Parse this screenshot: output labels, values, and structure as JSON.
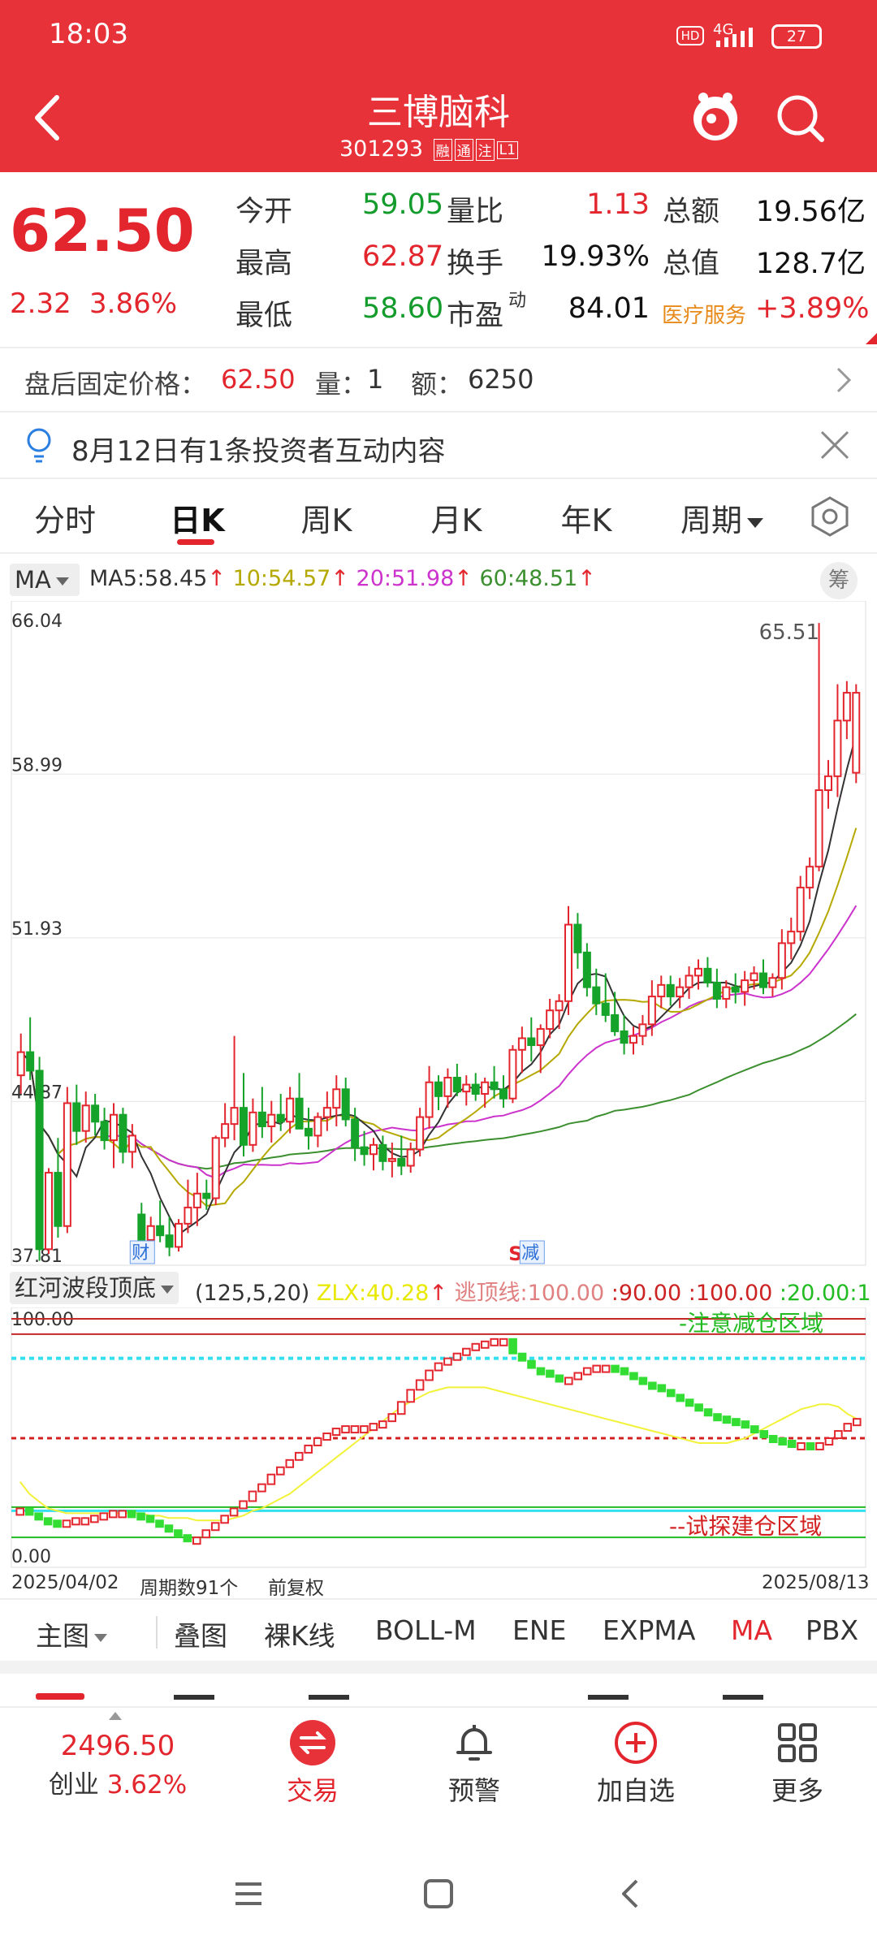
{
  "status_bar": {
    "time": "18:03",
    "network": "4G",
    "battery": "27"
  },
  "header": {
    "title": "三博脑科",
    "code": "301293",
    "badges": [
      "融",
      "通",
      "注",
      "L1"
    ]
  },
  "quote": {
    "price": "62.50",
    "change": "2.32",
    "change_pct": "3.86%",
    "open_label": "今开",
    "open": "59.05",
    "high_label": "最高",
    "high": "62.87",
    "low_label": "最低",
    "low": "58.60",
    "volratio_label": "量比",
    "volratio": "1.13",
    "turnover_label": "换手",
    "turnover": "19.93%",
    "pe_label": "市盈",
    "pe_sup": "动",
    "pe": "84.01",
    "amount_label": "总额",
    "amount": "19.56亿",
    "mktcap_label": "总值",
    "mktcap": "128.7亿",
    "sector": "医疗服务",
    "sector_pct": "+3.89%"
  },
  "afterhours": {
    "label": "盘后固定价格：",
    "price": "62.50",
    "vol_label": "量：",
    "vol": "1",
    "amt_label": "额：",
    "amt": "6250"
  },
  "notice": {
    "text": "8月12日有1条投资者互动内容"
  },
  "period_tabs": [
    "分时",
    "日K",
    "周K",
    "月K",
    "年K",
    "周期"
  ],
  "ma_legend": {
    "selector": "MA",
    "ma5": "MA5:58.45",
    "ma10": "10:54.57",
    "ma20": "20:51.98",
    "ma60": "60:48.51",
    "chip_btn": "筹"
  },
  "colors": {
    "up": "#e3262e",
    "down": "#16a32a",
    "ma5": "#333333",
    "ma10": "#b5a800",
    "ma20": "#cc33cc",
    "ma60": "#3b8f2e"
  },
  "chart_data": [
    {
      "type": "candlestick",
      "title": "",
      "ylim": [
        37.81,
        66.04
      ],
      "yticks": [
        "66.04",
        "58.99",
        "51.93",
        "44.87",
        "37.81"
      ],
      "x_range": [
        "2025/04/02",
        "2025/08/13"
      ],
      "period_count_label": "周期数91个",
      "adjust_label": "前复权",
      "max_label": "65.51",
      "event_markers": [
        {
          "label": "财",
          "index": 13
        },
        {
          "label": "减",
          "index": 55,
          "prefix": "S"
        }
      ],
      "ohlc": [
        [
          46.0,
          47.8,
          45.2,
          47.0
        ],
        [
          47.0,
          48.5,
          45.8,
          46.2
        ],
        [
          46.2,
          46.8,
          38.0,
          38.5
        ],
        [
          38.5,
          42.0,
          38.3,
          41.8
        ],
        [
          41.8,
          43.3,
          39.0,
          39.5
        ],
        [
          39.5,
          45.5,
          39.2,
          44.8
        ],
        [
          44.8,
          45.6,
          43.0,
          43.6
        ],
        [
          43.6,
          45.3,
          43.1,
          44.7
        ],
        [
          44.7,
          45.2,
          43.4,
          44.0
        ],
        [
          44.0,
          44.6,
          42.8,
          43.2
        ],
        [
          43.2,
          44.8,
          42.0,
          44.3
        ],
        [
          44.3,
          44.6,
          42.2,
          42.7
        ],
        [
          42.7,
          43.9,
          42.0,
          43.4
        ],
        [
          40.0,
          40.5,
          38.3,
          38.9
        ],
        [
          38.9,
          39.9,
          38.1,
          39.5
        ],
        [
          39.5,
          40.6,
          38.8,
          39.1
        ],
        [
          39.1,
          39.9,
          38.2,
          38.6
        ],
        [
          38.6,
          39.8,
          38.4,
          39.6
        ],
        [
          39.6,
          41.5,
          39.2,
          40.3
        ],
        [
          40.3,
          41.8,
          39.5,
          40.9
        ],
        [
          40.9,
          41.5,
          40.2,
          40.7
        ],
        [
          40.7,
          43.4,
          40.4,
          43.3
        ],
        [
          43.3,
          44.8,
          42.9,
          43.9
        ],
        [
          43.9,
          47.7,
          43.2,
          44.6
        ],
        [
          44.6,
          46.1,
          42.5,
          43.0
        ],
        [
          43.0,
          45.0,
          42.7,
          44.4
        ],
        [
          44.4,
          45.5,
          43.3,
          43.8
        ],
        [
          43.8,
          44.9,
          43.1,
          44.3
        ],
        [
          44.3,
          45.2,
          43.6,
          44.0
        ],
        [
          44.0,
          45.5,
          43.5,
          45.0
        ],
        [
          45.0,
          46.1,
          43.9,
          43.7
        ],
        [
          43.7,
          44.6,
          42.8,
          43.4
        ],
        [
          43.4,
          44.4,
          42.9,
          44.2
        ],
        [
          44.2,
          45.3,
          43.6,
          44.6
        ],
        [
          44.6,
          46.0,
          43.8,
          45.4
        ],
        [
          45.4,
          45.9,
          43.8,
          44.1
        ],
        [
          44.1,
          44.6,
          42.3,
          42.9
        ],
        [
          42.9,
          43.6,
          42.1,
          42.6
        ],
        [
          42.6,
          43.3,
          41.9,
          43.0
        ],
        [
          43.0,
          43.4,
          41.9,
          42.3
        ],
        [
          42.3,
          43.1,
          41.6,
          42.4
        ],
        [
          42.4,
          43.4,
          41.7,
          42.1
        ],
        [
          42.1,
          43.1,
          41.8,
          42.8
        ],
        [
          42.8,
          44.6,
          42.5,
          44.2
        ],
        [
          44.2,
          46.4,
          43.7,
          45.7
        ],
        [
          45.7,
          46.0,
          44.5,
          45.1
        ],
        [
          45.1,
          46.3,
          44.6,
          45.9
        ],
        [
          45.9,
          46.5,
          45.1,
          45.3
        ],
        [
          45.3,
          46.0,
          44.7,
          45.6
        ],
        [
          45.6,
          46.1,
          44.9,
          45.2
        ],
        [
          45.2,
          45.9,
          44.6,
          45.7
        ],
        [
          45.7,
          46.4,
          45.0,
          45.4
        ],
        [
          45.4,
          46.0,
          44.6,
          45.0
        ],
        [
          45.0,
          47.3,
          44.8,
          47.1
        ],
        [
          47.1,
          48.1,
          46.1,
          47.6
        ],
        [
          47.6,
          48.5,
          46.6,
          47.3
        ],
        [
          47.3,
          48.2,
          46.1,
          48.0
        ],
        [
          48.0,
          49.3,
          47.6,
          48.8
        ],
        [
          48.8,
          49.5,
          48.0,
          49.2
        ],
        [
          49.2,
          53.3,
          48.6,
          52.5
        ],
        [
          52.5,
          53.0,
          50.6,
          51.3
        ],
        [
          51.3,
          51.7,
          49.4,
          49.8
        ],
        [
          49.8,
          50.6,
          48.6,
          49.1
        ],
        [
          49.1,
          50.4,
          48.3,
          48.6
        ],
        [
          48.6,
          49.6,
          47.7,
          47.9
        ],
        [
          47.9,
          48.6,
          46.9,
          47.4
        ],
        [
          47.4,
          48.1,
          46.9,
          47.7
        ],
        [
          47.7,
          48.6,
          47.3,
          48.2
        ],
        [
          48.2,
          50.1,
          47.7,
          49.4
        ],
        [
          49.4,
          50.3,
          48.9,
          49.9
        ],
        [
          49.9,
          50.3,
          49.0,
          49.4
        ],
        [
          49.4,
          50.2,
          48.9,
          49.8
        ],
        [
          49.8,
          50.7,
          49.3,
          50.3
        ],
        [
          50.3,
          51.0,
          49.7,
          50.6
        ],
        [
          50.6,
          51.1,
          49.8,
          50.0
        ],
        [
          50.0,
          50.6,
          48.9,
          49.3
        ],
        [
          49.3,
          50.1,
          48.9,
          49.8
        ],
        [
          49.8,
          50.4,
          49.1,
          49.6
        ],
        [
          49.6,
          50.5,
          49.0,
          50.1
        ],
        [
          50.1,
          50.7,
          49.7,
          50.4
        ],
        [
          50.4,
          51.0,
          49.5,
          49.8
        ],
        [
          49.8,
          50.4,
          49.4,
          50.2
        ],
        [
          50.2,
          52.3,
          49.7,
          51.7
        ],
        [
          51.7,
          52.8,
          51.0,
          52.2
        ],
        [
          52.2,
          54.6,
          51.8,
          54.1
        ],
        [
          54.1,
          55.4,
          53.6,
          55.0
        ],
        [
          55.0,
          65.51,
          54.8,
          58.3
        ],
        [
          58.3,
          59.6,
          57.5,
          58.9
        ],
        [
          58.9,
          62.87,
          58.0,
          61.3
        ],
        [
          61.3,
          63.0,
          60.5,
          62.5
        ],
        [
          59.05,
          62.87,
          58.6,
          62.5
        ]
      ],
      "ma_last": {
        "MA5": 58.45,
        "MA10": 54.57,
        "MA20": 51.98,
        "MA60": 48.51
      }
    },
    {
      "type": "line",
      "title": "",
      "name_label": "红河波段顶底",
      "params": "(125,5,20)",
      "zlx": "ZLX:40.28",
      "escape_line": "逃顶线:100.00",
      "v90": ":90.00",
      "v100": ":100.00",
      "v20": ":20.00",
      "v1": ":1",
      "ylim": [
        0,
        100
      ],
      "yticks": [
        "100.00",
        "0.00"
      ],
      "zone_top_label": "-注意减仓区域",
      "zone_bottom_label": "--试探建仓区域",
      "series": [
        {
          "values": [
            21,
            19,
            17,
            16,
            15,
            16,
            17,
            17,
            18,
            19,
            20,
            20,
            19,
            18,
            16,
            14,
            12,
            10,
            9,
            9,
            12,
            15,
            18,
            21,
            24,
            28,
            31,
            35,
            38,
            41,
            44,
            47,
            50,
            52,
            54,
            55,
            55,
            55,
            56,
            57,
            60,
            65,
            70,
            74,
            78,
            81,
            83,
            85,
            87,
            89,
            90,
            91,
            91,
            85,
            82,
            79,
            78,
            76,
            75,
            75,
            77,
            79,
            80,
            80,
            79,
            77,
            75,
            73,
            72,
            70,
            68,
            66,
            64,
            62,
            60,
            59,
            58,
            57,
            55,
            53,
            51,
            50,
            49,
            48,
            48,
            47,
            48,
            50,
            53,
            56,
            58
          ]
        },
        {
          "values": [
            32,
            27,
            24,
            21,
            20,
            19,
            19,
            19,
            19,
            19,
            19,
            19,
            19,
            19,
            18,
            18,
            17,
            17,
            17,
            16,
            16,
            16,
            16,
            17,
            18,
            20,
            21,
            23,
            25,
            27,
            30,
            33,
            36,
            39,
            42,
            45,
            48,
            51,
            54,
            57,
            60,
            63,
            65,
            67,
            69,
            70,
            71,
            71,
            71,
            71,
            71,
            70,
            69,
            68,
            67,
            66,
            65,
            64,
            63,
            62,
            61,
            60,
            59,
            58,
            57,
            56,
            55,
            54,
            53,
            52,
            51,
            50,
            49,
            48,
            48,
            48,
            48,
            49,
            50,
            52,
            54,
            56,
            58,
            60,
            62,
            63,
            64,
            64,
            63,
            60,
            58
          ]
        }
      ]
    }
  ],
  "bottom_indicator_tabs": [
    "主图",
    "叠图",
    "裸K线",
    "BOLL-M",
    "ENE",
    "EXPMA",
    "MA",
    "PBX"
  ],
  "bottom_nav": {
    "index_value": "2496.50",
    "index_name": "创业",
    "index_pct": "3.62%",
    "trade": "交易",
    "alert": "预警",
    "add_fav": "加自选",
    "more": "更多"
  }
}
